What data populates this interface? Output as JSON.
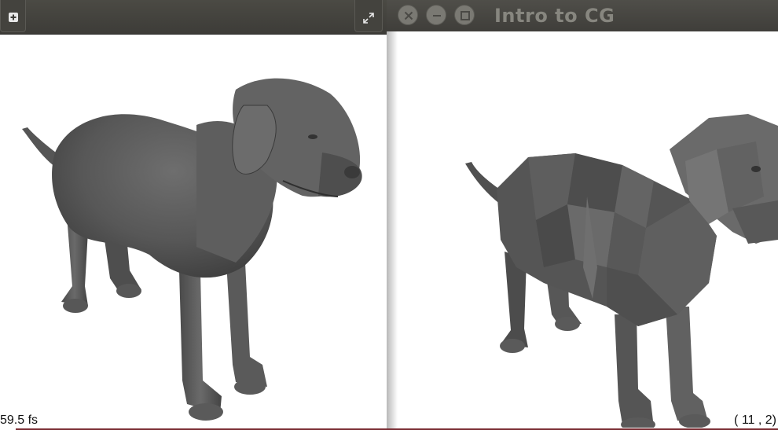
{
  "left_window": {
    "buttons": [
      {
        "name": "add",
        "icon": "plus-icon"
      },
      {
        "name": "maximize",
        "icon": "expand-icon"
      }
    ],
    "model": "dog-smooth-shaded"
  },
  "right_window": {
    "title": "Intro to CG",
    "controls": [
      {
        "name": "close",
        "icon": "close-icon"
      },
      {
        "name": "minimize",
        "icon": "minimize-icon"
      },
      {
        "name": "maximize",
        "icon": "maximize-icon"
      }
    ],
    "model": "dog-flat-shaded"
  },
  "status": {
    "fps": "59.5 fs",
    "mouse": "( 11 ,   2)"
  },
  "colors": {
    "titlebar": "#3f3e3a",
    "title_text": "#87867f",
    "model_gray": "#5a5a5a",
    "accent_line": "#7a2d33"
  }
}
